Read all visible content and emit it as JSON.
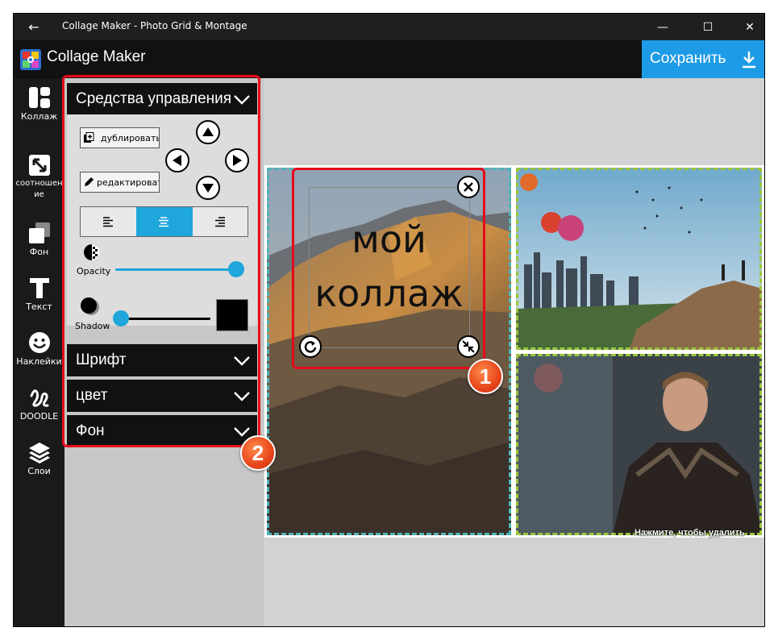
{
  "window": {
    "title": "Collage Maker - Photo Grid & Montage",
    "back_glyph": "←",
    "minimize_glyph": "—",
    "maximize_glyph": "☐",
    "close_glyph": "✕"
  },
  "header": {
    "app_name": "Collage Maker",
    "save_label": "Сохранить",
    "save_color": "#1e9be6"
  },
  "nav": [
    {
      "label": "Коллаж",
      "icon": "layout-icon"
    },
    {
      "label": "соотношение",
      "icon": "resize-icon"
    },
    {
      "label": "Фон",
      "icon": "background-icon"
    },
    {
      "label": "Текст",
      "icon": "text-icon"
    },
    {
      "label": "Наклейки",
      "icon": "sticker-icon"
    },
    {
      "label": "DOODLE",
      "icon": "doodle-icon"
    },
    {
      "label": "Слои",
      "icon": "layers-icon"
    }
  ],
  "panel": {
    "controls_title": "Средства управления",
    "duplicate_label": "дублировать",
    "edit_label": "редактировать",
    "opacity_label": "Opacity",
    "opacity_value": 1.0,
    "shadow_label": "Shadow",
    "shadow_value": 0.0,
    "shadow_color": "#000000",
    "text_align": "center",
    "font_title": "Шрифт",
    "color_title": "цвет",
    "background_title": "Фон",
    "accent_color": "#1fa6db"
  },
  "canvas": {
    "text_line1": "мой",
    "text_line2": "коллаж",
    "delete_hint": "Нажмите, чтобы удалить"
  },
  "annotations": {
    "badge1": "1",
    "badge2": "2"
  }
}
